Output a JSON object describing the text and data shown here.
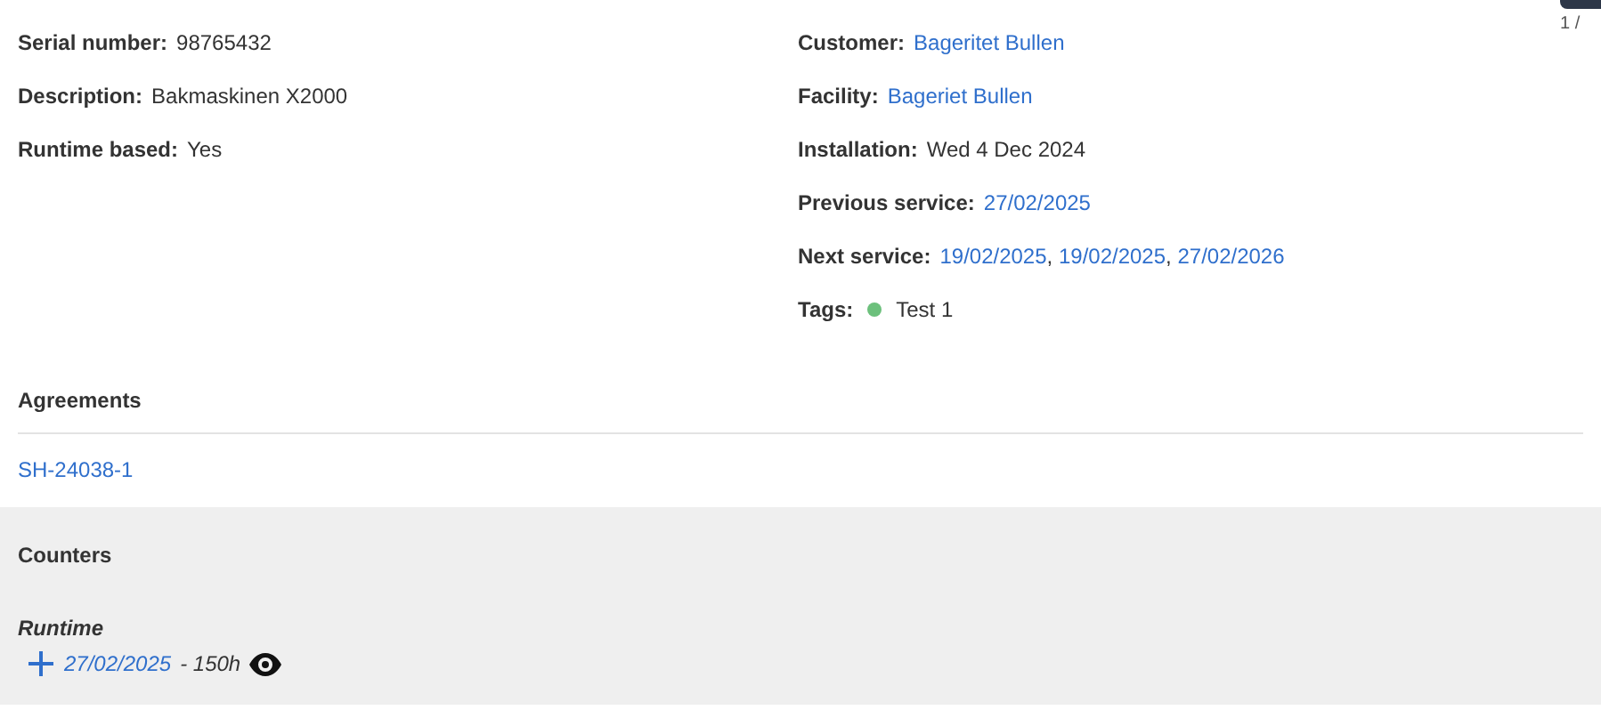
{
  "pager": {
    "label": "1 /"
  },
  "left_fields": [
    {
      "label": "Serial number:",
      "kind": "text",
      "value": "98765432"
    },
    {
      "label": "Description:",
      "kind": "text",
      "value": "Bakmaskinen X2000"
    },
    {
      "label": "Runtime based:",
      "kind": "text",
      "value": "Yes"
    }
  ],
  "right_fields": [
    {
      "label": "Customer:",
      "kind": "links",
      "links": [
        "Bageritet Bullen"
      ]
    },
    {
      "label": "Facility:",
      "kind": "links",
      "links": [
        "Bageriet Bullen"
      ]
    },
    {
      "label": "Installation:",
      "kind": "text",
      "value": "Wed 4 Dec 2024"
    },
    {
      "label": "Previous service:",
      "kind": "links",
      "links": [
        "27/02/2025"
      ]
    },
    {
      "label": "Next service:",
      "kind": "links",
      "links": [
        "19/02/2025",
        "19/02/2025",
        "27/02/2026"
      ],
      "separator": ","
    },
    {
      "label": "Tags:",
      "kind": "tags",
      "tags": [
        {
          "name": "Test 1",
          "color": "#6cc07c"
        }
      ]
    }
  ],
  "agreements": {
    "title": "Agreements",
    "items": [
      "SH-24038-1"
    ]
  },
  "counters": {
    "title": "Counters",
    "groups": [
      {
        "name": "Runtime",
        "entries": [
          {
            "date": "27/02/2025",
            "reading": "- 150h"
          }
        ]
      }
    ]
  }
}
